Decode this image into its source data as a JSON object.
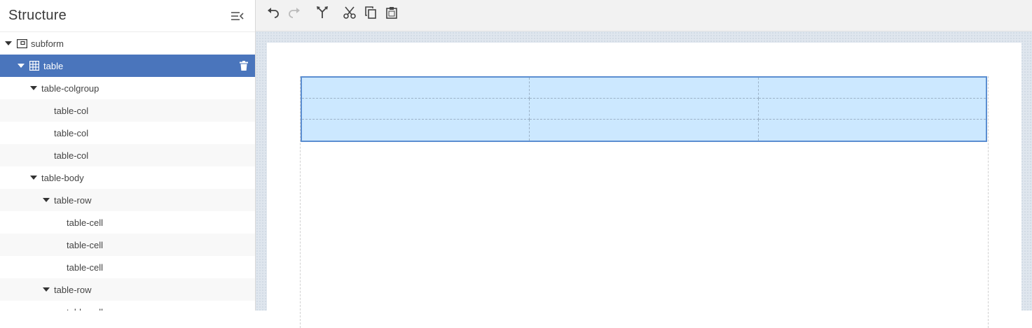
{
  "sidebar": {
    "title": "Structure",
    "items": [
      {
        "label": "subform",
        "depth": 0,
        "expandable": true,
        "icon": "subform-icon"
      },
      {
        "label": "table",
        "depth": 1,
        "expandable": true,
        "icon": "table-grid-icon",
        "selected": true
      },
      {
        "label": "table-colgroup",
        "depth": 2,
        "expandable": true
      },
      {
        "label": "table-col",
        "depth": 3,
        "expandable": false
      },
      {
        "label": "table-col",
        "depth": 3,
        "expandable": false
      },
      {
        "label": "table-col",
        "depth": 3,
        "expandable": false
      },
      {
        "label": "table-body",
        "depth": 2,
        "expandable": true
      },
      {
        "label": "table-row",
        "depth": 3,
        "expandable": true
      },
      {
        "label": "table-cell",
        "depth": 4,
        "expandable": false
      },
      {
        "label": "table-cell",
        "depth": 4,
        "expandable": false
      },
      {
        "label": "table-cell",
        "depth": 4,
        "expandable": false
      },
      {
        "label": "table-row",
        "depth": 3,
        "expandable": true
      },
      {
        "label": "table-cell",
        "depth": 4,
        "expandable": false
      }
    ]
  },
  "toolbar": {
    "buttons": [
      "undo-icon",
      "redo-icon",
      "merge-icon",
      "cut-icon",
      "copy-icon",
      "paste-icon"
    ]
  },
  "colors": {
    "selection": "#4a75bc",
    "table_fill": "#cce8ff",
    "table_border": "#5b8ed1"
  }
}
